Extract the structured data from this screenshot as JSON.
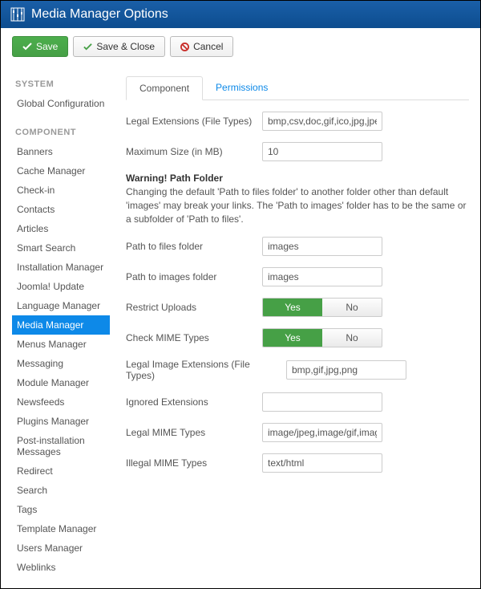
{
  "header": {
    "title": "Media Manager Options"
  },
  "buttons": {
    "save": "Save",
    "save_close": "Save & Close",
    "cancel": "Cancel"
  },
  "sidebar": {
    "system_head": "SYSTEM",
    "system_items": [
      "Global Configuration"
    ],
    "component_head": "COMPONENT",
    "component_items": [
      "Banners",
      "Cache Manager",
      "Check-in",
      "Contacts",
      "Articles",
      "Smart Search",
      "Installation Manager",
      "Joomla! Update",
      "Language Manager",
      "Media Manager",
      "Menus Manager",
      "Messaging",
      "Module Manager",
      "Newsfeeds",
      "Plugins Manager",
      "Post-installation Messages",
      "Redirect",
      "Search",
      "Tags",
      "Template Manager",
      "Users Manager",
      "Weblinks"
    ],
    "active": "Media Manager"
  },
  "tabs": {
    "component": "Component",
    "permissions": "Permissions"
  },
  "form": {
    "legal_ext_label": "Legal Extensions (File Types)",
    "legal_ext_value": "bmp,csv,doc,gif,ico,jpg,jpeg,odg,odp",
    "max_size_label": "Maximum Size (in MB)",
    "max_size_value": "10",
    "warn_title": "Warning! Path Folder",
    "warn_body": "Changing the default 'Path to files folder' to another folder other than default 'images' may break your links. The 'Path to images' folder has to be the same or a subfolder of 'Path to files'.",
    "path_files_label": "Path to files folder",
    "path_files_value": "images",
    "path_images_label": "Path to images folder",
    "path_images_value": "images",
    "restrict_label": "Restrict Uploads",
    "check_mime_label": "Check MIME Types",
    "toggle_yes": "Yes",
    "toggle_no": "No",
    "legal_img_label": "Legal Image Extensions (File Types)",
    "legal_img_value": "bmp,gif,jpg,png",
    "ignored_label": "Ignored Extensions",
    "ignored_value": "",
    "legal_mime_label": "Legal MIME Types",
    "legal_mime_value": "image/jpeg,image/gif,image/png,ima",
    "illegal_mime_label": "Illegal MIME Types",
    "illegal_mime_value": "text/html"
  }
}
